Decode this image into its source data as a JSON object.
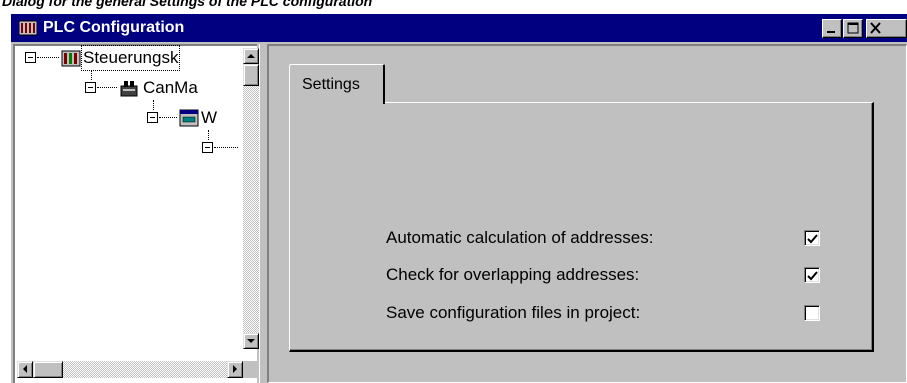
{
  "caption": "Dialog for the general Settings of the PLC configuration",
  "window": {
    "title": "PLC Configuration",
    "title_icon": "plc-config-icon",
    "buttons": [
      "minimize",
      "maximize",
      "close"
    ]
  },
  "tree": {
    "nodes": [
      {
        "label": "Steuerungsk",
        "icon": "plc-rack-icon",
        "level": 0
      },
      {
        "label": "CanMa",
        "icon": "can-master-icon",
        "level": 1
      },
      {
        "label": "W",
        "icon": "module-icon",
        "level": 2
      },
      {
        "label": "",
        "icon": "",
        "level": 3
      }
    ]
  },
  "tab": {
    "label": "Settings"
  },
  "settings": [
    {
      "label": "Automatic calculation of addresses:",
      "checked": true
    },
    {
      "label": "Check for overlapping addresses:",
      "checked": true
    },
    {
      "label": "Save configuration files in project:",
      "checked": false
    }
  ]
}
